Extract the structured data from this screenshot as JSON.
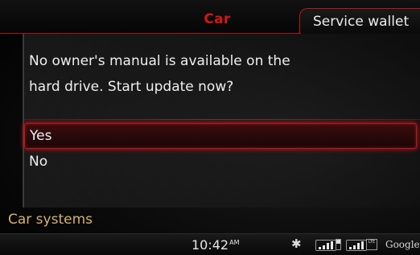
{
  "header": {
    "active_tab": "Car",
    "secondary_tab": "Service wallet"
  },
  "dialog": {
    "message_line1": "No owner's manual is available on the",
    "message_line2": "hard drive. Start update now?",
    "options": [
      {
        "label": "Yes",
        "selected": true
      },
      {
        "label": "No",
        "selected": false
      }
    ]
  },
  "section": {
    "label": "Car systems"
  },
  "status_bar": {
    "time": "10:42",
    "meridiem": "AM",
    "icons": [
      "bluetooth-icon",
      "signal-strength-icon",
      "sim-icon",
      "lte-signal-icon",
      "lte-badge-icon"
    ],
    "provider": "Google"
  },
  "colors": {
    "accent_red": "#d4161a",
    "section_gold": "#d6b26a"
  }
}
